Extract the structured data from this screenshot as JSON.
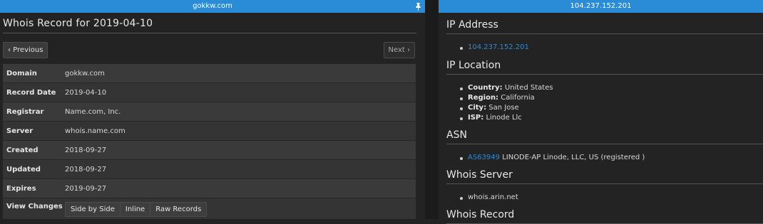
{
  "left": {
    "title": "gokkw.com",
    "heading": "Whois Record for 2019-04-10",
    "prev_label": "‹ Previous",
    "next_label": "Next ›",
    "rows": [
      {
        "key": "Domain",
        "value": "gokkw.com"
      },
      {
        "key": "Record Date",
        "value": "2019-04-10"
      },
      {
        "key": "Registrar",
        "value": "Name.com, Inc."
      },
      {
        "key": "Server",
        "value": "whois.name.com"
      },
      {
        "key": "Created",
        "value": "2018-09-27"
      },
      {
        "key": "Updated",
        "value": "2018-09-27"
      },
      {
        "key": "Expires",
        "value": "2019-09-27"
      }
    ],
    "view_changes": {
      "key": "View Changes",
      "buttons": [
        "Side by Side",
        "Inline",
        "Raw Records"
      ]
    }
  },
  "right": {
    "title": "104.237.152.201",
    "ip_address": {
      "heading": "IP Address",
      "value": "104.237.152.201"
    },
    "ip_location": {
      "heading": "IP Location",
      "items": [
        {
          "label": "Country:",
          "value": "United States"
        },
        {
          "label": "Region:",
          "value": "California"
        },
        {
          "label": "City:",
          "value": "San Jose"
        },
        {
          "label": "ISP:",
          "value": "Linode Llc"
        }
      ]
    },
    "asn": {
      "heading": "ASN",
      "link": "AS63949",
      "text": "LINODE-AP Linode, LLC, US (registered )"
    },
    "whois_server": {
      "heading": "Whois Server",
      "value": "whois.arin.net"
    },
    "whois_record": {
      "heading": "Whois Record"
    }
  },
  "colors": {
    "accent": "#2a8bd6",
    "background": "#232323"
  },
  "icons": {
    "pin": "pin-icon"
  }
}
